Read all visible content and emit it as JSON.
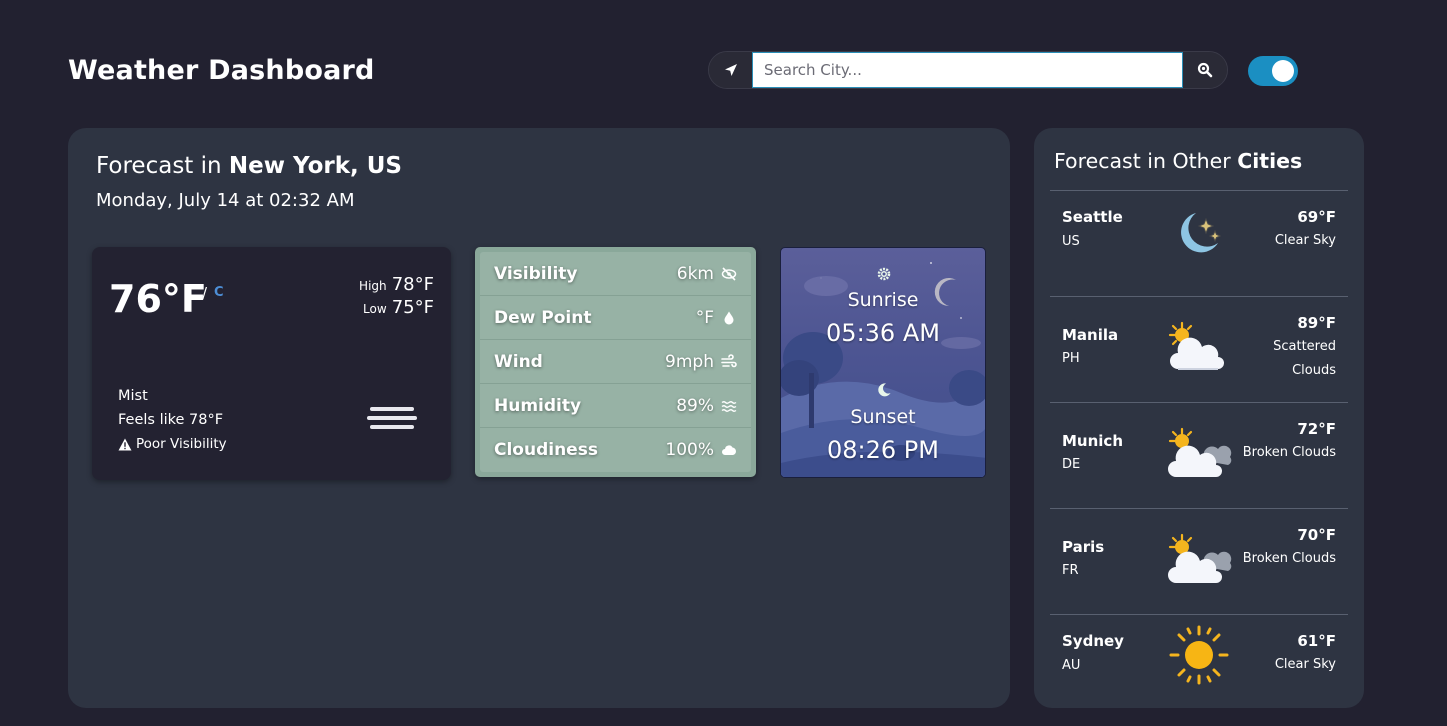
{
  "header": {
    "title": "Weather Dashboard",
    "search_placeholder": "Search City..."
  },
  "theme": {
    "dark_mode": true,
    "accent": "#1b8fc2"
  },
  "main": {
    "heading_prefix": "Forecast in",
    "location": "New York, US",
    "date": "Monday, July 14 at 02:32 AM",
    "current": {
      "temp": "76°F",
      "unit_separator": "/",
      "alt_unit": "C",
      "high_label": "High",
      "high": "78°F",
      "low_label": "Low",
      "low": "75°F",
      "condition": "Mist",
      "feels_like": "Feels like 78°F",
      "warning": "Poor Visibility",
      "icon": "mist-icon"
    },
    "details": [
      {
        "label": "Visibility",
        "value": "6km",
        "icon": "eye-slash-icon"
      },
      {
        "label": "Dew Point",
        "value": "°F",
        "icon": "droplet-icon"
      },
      {
        "label": "Wind",
        "value": "9mph",
        "icon": "wind-icon"
      },
      {
        "label": "Humidity",
        "value": "89%",
        "icon": "water-icon"
      },
      {
        "label": "Cloudiness",
        "value": "100%",
        "icon": "cloud-icon"
      }
    ],
    "sun": {
      "sunrise_label": "Sunrise",
      "sunrise_time": "05:36 AM",
      "sunset_label": "Sunset",
      "sunset_time": "08:26 PM"
    }
  },
  "side": {
    "heading_prefix": "Forecast in Other",
    "heading_bold": "Cities",
    "cities": [
      {
        "name": "Seattle",
        "country": "US",
        "temp": "69°F",
        "condition": "Clear Sky",
        "icon": "moon-stars-icon"
      },
      {
        "name": "Manila",
        "country": "PH",
        "temp": "89°F",
        "condition": "Scattered Clouds",
        "icon": "sun-cloud-icon"
      },
      {
        "name": "Munich",
        "country": "DE",
        "temp": "72°F",
        "condition": "Broken Clouds",
        "icon": "sun-clouds-icon"
      },
      {
        "name": "Paris",
        "country": "FR",
        "temp": "70°F",
        "condition": "Broken Clouds",
        "icon": "sun-clouds-icon"
      },
      {
        "name": "Sydney",
        "country": "AU",
        "temp": "61°F",
        "condition": "Clear Sky",
        "icon": "sun-icon"
      }
    ]
  }
}
